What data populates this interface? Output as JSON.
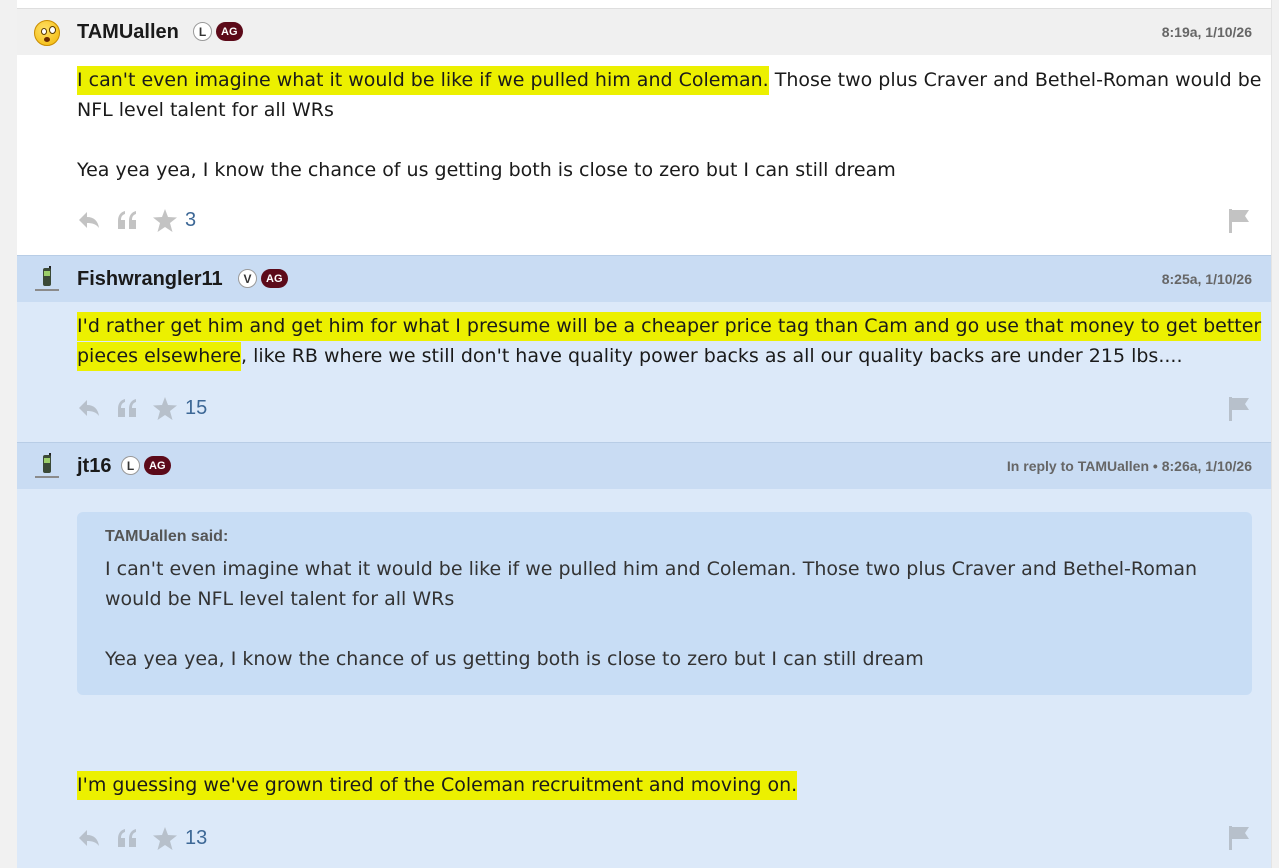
{
  "posts": [
    {
      "username": "TAMUallen",
      "badge_letter": "L",
      "badge_group": "AG",
      "avatar_icon": "surprised-emoji-icon",
      "timestamp": "8:19a, 1/10/26",
      "body": [
        {
          "hl": "I can't even imagine what it would be like if we pulled him and Coleman.",
          "rest": " Those two plus Craver and Bethel-Roman would be"
        },
        {
          "hl": "",
          "rest": "NFL level talent for all WRs"
        },
        {
          "hl": "",
          "rest": "Yea yea yea, I know the chance of us getting both is close to zero but I can still dream"
        }
      ],
      "like_count": "3"
    },
    {
      "username": "Fishwrangler11",
      "badge_letter": "V",
      "badge_group": "AG",
      "avatar_icon": "cell-phone-icon",
      "timestamp": "8:25a, 1/10/26",
      "body": [
        {
          "hl": "I'd rather get him and get him for what I presume will be a cheaper price tag than Cam and go use that money to get better",
          "rest": ""
        },
        {
          "hl": "pieces elsewhere",
          "rest": ", like RB where we still don't have quality power backs as all our quality backs are under 215 lbs...."
        }
      ],
      "like_count": "15"
    },
    {
      "username": "jt16",
      "badge_letter": "L",
      "badge_group": "AG",
      "avatar_icon": "cell-phone-icon",
      "reply_prefix": "In reply to TAMUallen",
      "reply_sep": " • ",
      "timestamp": "8:26a, 1/10/26",
      "quote": {
        "author": "TAMUallen said:",
        "lines": [
          "I can't even imagine what it would be like if we pulled him and Coleman. Those two plus Craver and Bethel-Roman",
          "would be NFL level talent for all WRs",
          "Yea yea yea, I know the chance of us getting both is close to zero but I can still dream"
        ]
      },
      "body": [
        {
          "hl": "I'm guessing we've grown tired of the Coleman recruitment and moving on.",
          "rest": ""
        }
      ],
      "like_count": "13"
    }
  ],
  "action_icons": [
    "reply-icon",
    "quote-icon",
    "star-icon",
    "flag-icon"
  ],
  "colors": {
    "highlight": "#ecf000",
    "badge_ag": "#5c0a19",
    "like_count": "#3d6896",
    "reply_bg": "#dce9f9",
    "quote_bg": "#c8ddf5"
  }
}
